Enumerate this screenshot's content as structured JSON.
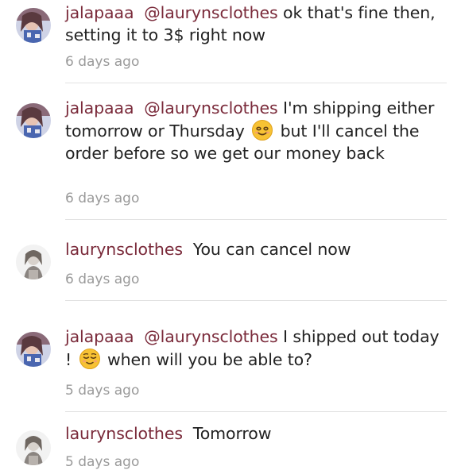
{
  "comments": [
    {
      "username": "jalapaaa",
      "mention": "@laurynsclothes",
      "text_parts": [
        "ok that's fine then, setting it to 3$ right now"
      ],
      "timestamp": "6 days ago",
      "avatar": "user-photo-jalapaaa"
    },
    {
      "username": "jalapaaa",
      "mention": "@laurynsclothes",
      "text_parts": [
        "I'm shipping either tomorrow or Thursday",
        "but I'll cancel the order before so we get our money back"
      ],
      "emoji": "smiling-face-emoji",
      "timestamp": "6 days ago",
      "avatar": "user-photo-jalapaaa"
    },
    {
      "username": "laurynsclothes",
      "mention": "",
      "text_parts": [
        "You can cancel now"
      ],
      "timestamp": "6 days ago",
      "avatar": "user-photo-laurynsclothes"
    },
    {
      "username": "jalapaaa",
      "mention": "@laurynsclothes",
      "text_parts": [
        "I shipped out today !",
        "when will you be able to?"
      ],
      "emoji": "relieved-face-emoji",
      "timestamp": "5 days ago",
      "avatar": "user-photo-jalapaaa"
    },
    {
      "username": "laurynsclothes",
      "mention": "",
      "text_parts": [
        "Tomorrow"
      ],
      "timestamp": "5 days ago",
      "avatar": "user-photo-laurynsclothes"
    }
  ],
  "colors": {
    "username": "#7a2a3a",
    "text": "#222222",
    "timestamp": "#9a9a9a",
    "divider": "#e2e2e2",
    "emoji": "#f7c234"
  }
}
